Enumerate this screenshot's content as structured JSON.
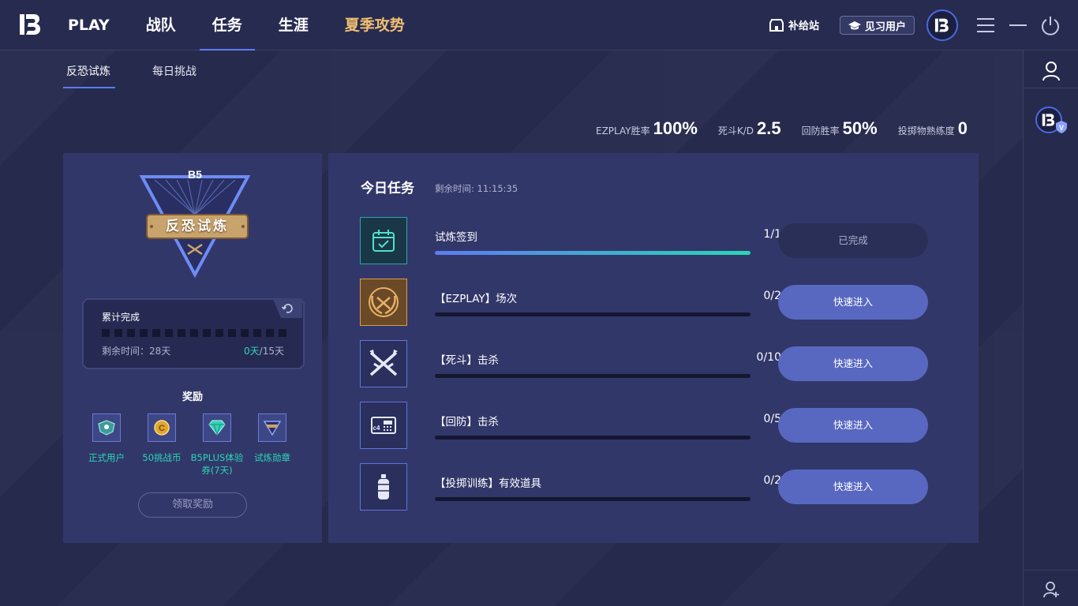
{
  "nav": {
    "items": [
      "PLAY",
      "战队",
      "任务",
      "生涯",
      "夏季攻势"
    ],
    "active_index": 2
  },
  "header": {
    "supply_label": "补给站",
    "user_badge_label": "见习用户"
  },
  "subtabs": [
    "反恐试炼",
    "每日挑战"
  ],
  "stats": [
    {
      "label": "EZPLAY胜率",
      "value": "100%"
    },
    {
      "label": "死斗K/D",
      "value": "2.5"
    },
    {
      "label": "回防胜率",
      "value": "50%"
    },
    {
      "label": "投掷物熟练度",
      "value": "0"
    }
  ],
  "trial": {
    "emblem_title": "反恐试炼",
    "progress_title": "累计完成",
    "squares_total": 15,
    "squares_done": 0,
    "remaining_text": "剩余时间：28天",
    "days_done": "0天",
    "days_total": "/15天",
    "reward_title": "奖励",
    "rewards": [
      {
        "label": "正式用户",
        "icon": "user-badge-icon"
      },
      {
        "label": "50挑战币",
        "icon": "coin-icon"
      },
      {
        "label": "B5PLUS体验券(7天)",
        "icon": "diamond-icon"
      },
      {
        "label": "试炼勋章",
        "icon": "medal-icon"
      }
    ],
    "claim_label": "领取奖励"
  },
  "daily": {
    "title": "今日任务",
    "time_text": "剩余时间: 11:15:35",
    "tasks": [
      {
        "name": "试炼签到",
        "count": "1/1",
        "progress": 1.0,
        "button": "已完成",
        "state": "done",
        "icon": "calendar-check-icon"
      },
      {
        "name": "【EZPLAY】场次",
        "count": "0/2",
        "progress": 0,
        "button": "快速进入",
        "state": "go",
        "icon": "laurel-swords-icon"
      },
      {
        "name": "【死斗】击杀",
        "count": "0/10",
        "progress": 0,
        "button": "快速进入",
        "state": "go",
        "icon": "crossed-rifles-icon"
      },
      {
        "name": "【回防】击杀",
        "count": "0/5",
        "progress": 0,
        "button": "快速进入",
        "state": "go",
        "icon": "c4-bomb-icon"
      },
      {
        "name": "【投掷训练】有效道具",
        "count": "0/2",
        "progress": 0,
        "button": "快速进入",
        "state": "go",
        "icon": "grenade-icon"
      }
    ]
  },
  "colors": {
    "accent": "#5e7bf3",
    "teal": "#2ad6b5",
    "summer": "#f0bf72",
    "card": "#32376a",
    "background": "#262a4d"
  }
}
